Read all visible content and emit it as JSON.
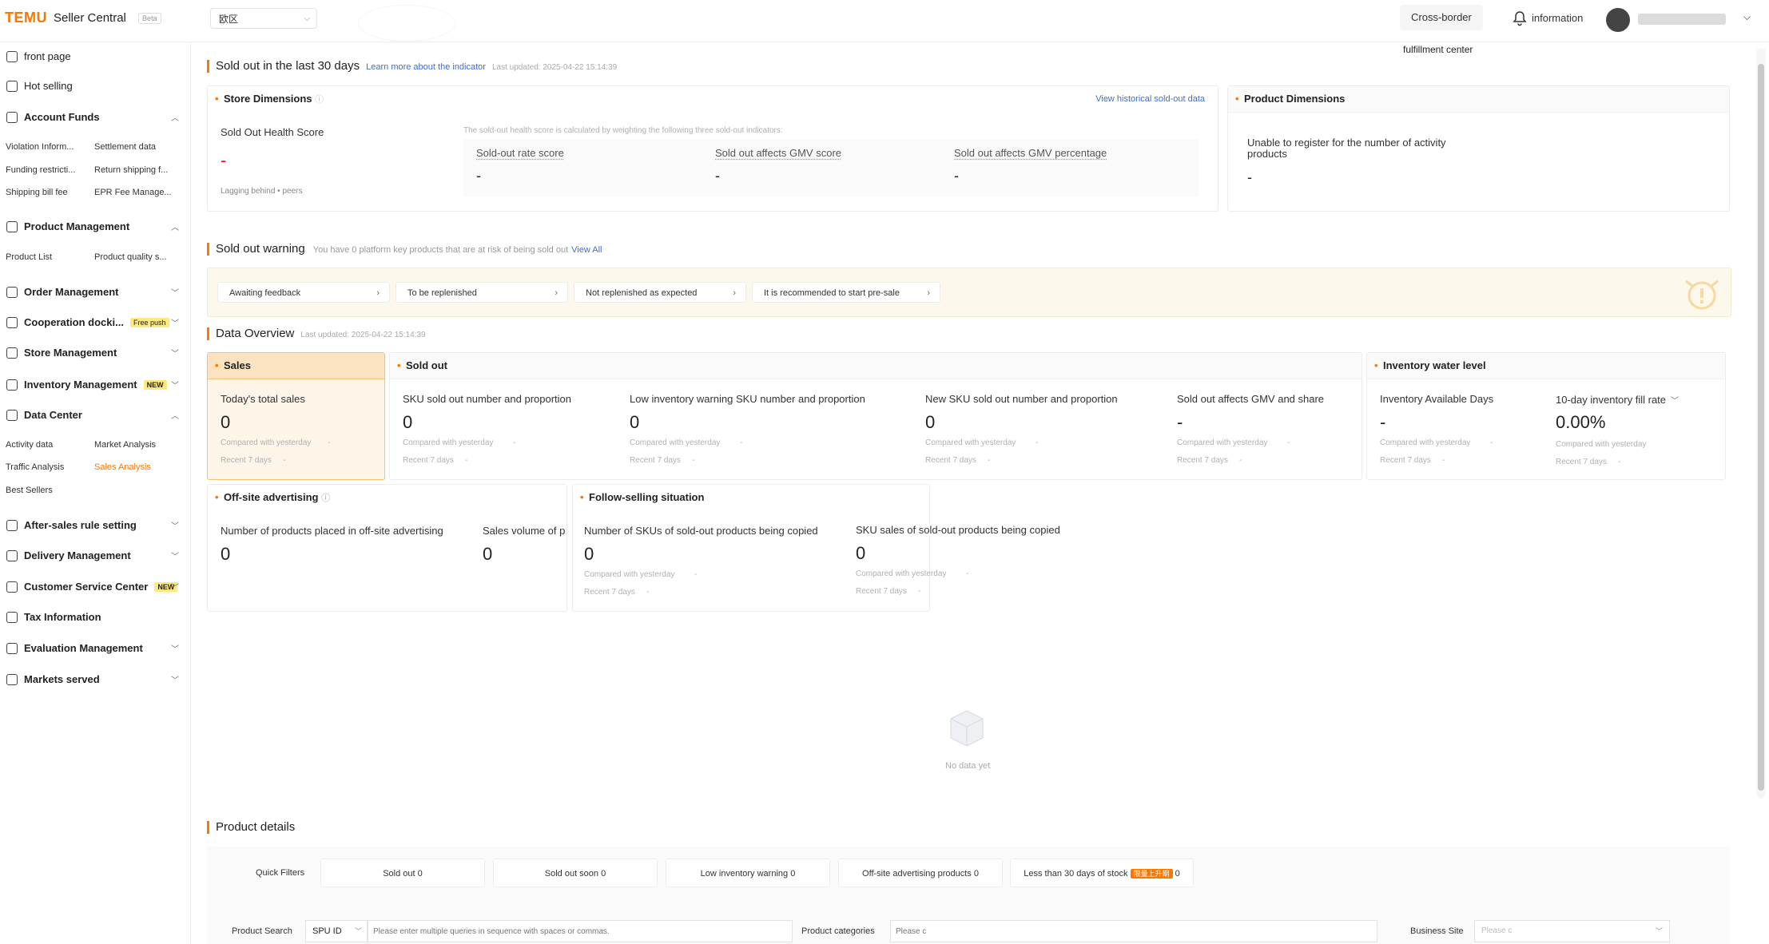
{
  "header": {
    "logo": "TEMU",
    "app_title": "Seller Central",
    "beta": "Beta",
    "region": "欧区",
    "cross_border": "Cross-border",
    "information": "information",
    "fulfillment_center": "fulfillment center"
  },
  "sidebar": {
    "items": [
      {
        "label": "front page"
      },
      {
        "label": "Hot selling"
      },
      {
        "label": "Account Funds"
      },
      {
        "label": "Product Management"
      },
      {
        "label": "Order Management"
      },
      {
        "label": "Cooperation docki...",
        "tag": "Free push"
      },
      {
        "label": "Store Management"
      },
      {
        "label": "Inventory Management",
        "tag": "NEW"
      },
      {
        "label": "Data Center"
      },
      {
        "label": "After-sales rule setting"
      },
      {
        "label": "Delivery Management"
      },
      {
        "label": "Customer Service Center",
        "tag": "NEW"
      },
      {
        "label": "Tax Information"
      },
      {
        "label": "Evaluation Management"
      },
      {
        "label": "Markets served"
      }
    ],
    "account_funds_sub": [
      "Violation Inform...",
      "Settlement data",
      "Funding restricti...",
      "Return shipping f...",
      "Shipping bill fee",
      "EPR Fee Manage..."
    ],
    "product_management_sub": [
      "Product List",
      "Product quality s..."
    ],
    "data_center_sub": [
      "Activity data",
      "Market Analysis",
      "Traffic Analysis",
      "Sales Analysis",
      "Best Sellers"
    ]
  },
  "soldout30": {
    "title": "Sold out in the last 30 days",
    "learn_more": "Learn more about the indicator",
    "last_updated": "Last updated: 2025-04-22 15:14:39",
    "store_dimensions": {
      "title": "Store Dimensions",
      "history_link": "View historical sold-out data",
      "health_score_label": "Sold Out Health Score",
      "health_score_value": "-",
      "lagging": "Lagging behind • peers",
      "note": "The sold-out health score is calculated by weighting the following three sold-out indicators:",
      "metrics": [
        {
          "label": "Sold-out rate score",
          "value": "-"
        },
        {
          "label": "Sold out affects GMV score",
          "value": "-"
        },
        {
          "label": "Sold out affects GMV percentage",
          "value": "-"
        }
      ]
    },
    "product_dimensions": {
      "title": "Product Dimensions",
      "text": "Unable to register for the number of activity products",
      "value": "-"
    }
  },
  "warning": {
    "title": "Sold out warning",
    "desc": "You have 0 platform key products that are at risk of being sold out",
    "view_all": "View All",
    "buttons": [
      "Awaiting feedback",
      "To be replenished",
      "Not replenished as expected",
      "It is recommended to start pre-sale"
    ]
  },
  "overview": {
    "title": "Data Overview",
    "last_updated": "Last updated: 2025-04-22 15:14:39",
    "sales": {
      "title": "Sales",
      "label": "Today's total sales",
      "value": "0",
      "compared": "Compared with yesterday",
      "recent": "Recent 7 days",
      "dash": "-"
    },
    "sold_out": {
      "title": "Sold out",
      "metrics": [
        {
          "label": "SKU sold out number and proportion",
          "value": "0"
        },
        {
          "label": "Low inventory warning SKU number and proportion",
          "value": "0"
        },
        {
          "label": "New SKU sold out number and proportion",
          "value": "0"
        },
        {
          "label": "Sold out affects GMV and share",
          "value": "-"
        }
      ],
      "compared": "Compared with yesterday",
      "recent": "Recent 7 days",
      "dash": "-"
    },
    "inventory": {
      "title": "Inventory water level",
      "metrics": [
        {
          "label": "Inventory Available Days",
          "value": "-"
        },
        {
          "label": "10-day inventory fill rate",
          "value": "0.00%"
        }
      ],
      "compared": "Compared with yesterday",
      "recent": "Recent 7 days",
      "dash": "-"
    },
    "offsite": {
      "title": "Off-site advertising",
      "metrics": [
        {
          "label": "Number of products placed in off-site advertising",
          "value": "0"
        },
        {
          "label": "Sales volume of products placed through off-site advertising",
          "value": "0"
        }
      ]
    },
    "follow": {
      "title": "Follow-selling situation",
      "metrics": [
        {
          "label": "Number of SKUs of sold-out products being copied",
          "value": "0"
        },
        {
          "label": "SKU sales of sold-out products being copied",
          "value": "0"
        }
      ],
      "compared": "Compared with yesterday",
      "recent": "Recent 7 days",
      "dash": "-"
    },
    "no_data": "No data yet"
  },
  "product_details": {
    "title": "Product details",
    "quick_filters_label": "Quick Filters",
    "quick_filters": [
      {
        "label": "Sold out",
        "count": "0"
      },
      {
        "label": "Sold out soon",
        "count": "0"
      },
      {
        "label": "Low inventory warning",
        "count": "0"
      },
      {
        "label": "Off-site advertising products",
        "count": "0"
      },
      {
        "label": "Less than 30 days of stock",
        "tag": "限量上升期",
        "count": "0"
      }
    ],
    "product_search_label": "Product Search",
    "search_type": "SPU ID",
    "search_placeholder": "Please enter multiple queries in sequence with spaces or commas.",
    "categories_label": "Product categories",
    "categories_placeholder": "Please c",
    "business_site_label": "Business Site",
    "business_site_placeholder": "Please c"
  },
  "colors": {
    "accent": "#fb7701",
    "link": "#3e6ed6",
    "alert": "#e02020"
  },
  "icons": [
    "home-icon",
    "fire-icon",
    "wallet-icon",
    "box-icon",
    "order-icon",
    "handshake-icon",
    "store-icon",
    "inventory-icon",
    "chart-icon",
    "refund-icon",
    "truck-icon",
    "headset-icon",
    "tax-icon",
    "star-icon",
    "globe-icon",
    "bell-icon",
    "info-icon",
    "alarm-icon",
    "empty-box-icon"
  ]
}
